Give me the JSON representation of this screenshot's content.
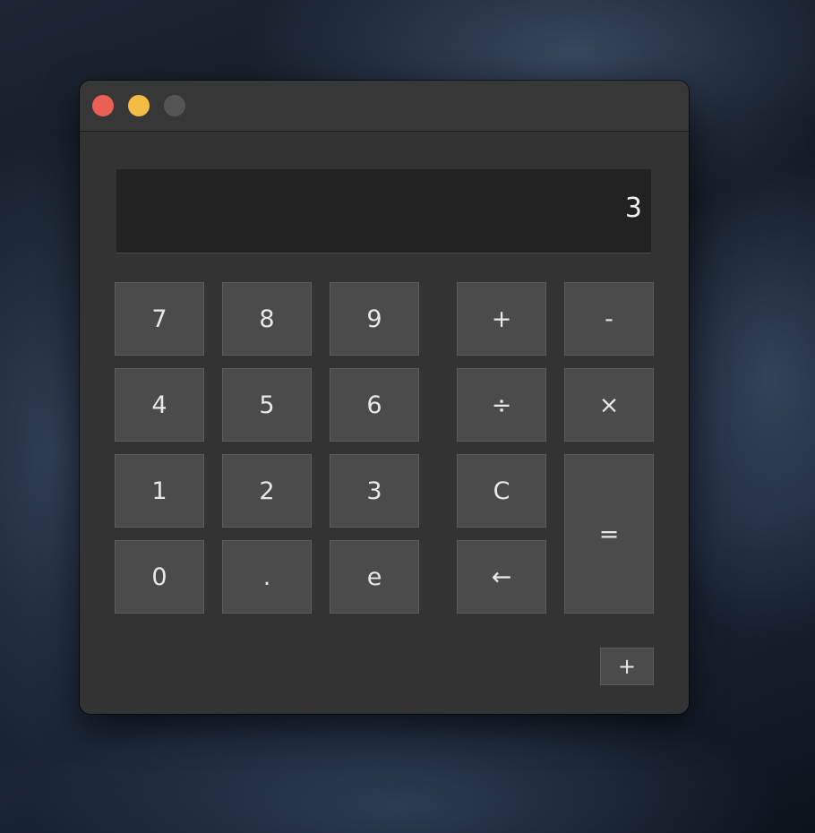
{
  "window": {
    "controls": [
      "close",
      "minimize",
      "zoom"
    ]
  },
  "display": {
    "value": "3"
  },
  "keys": {
    "k7": "7",
    "k8": "8",
    "k9": "9",
    "plus": "+",
    "minus": "-",
    "k4": "4",
    "k5": "5",
    "k6": "6",
    "divide": "÷",
    "multiply": "×",
    "k1": "1",
    "k2": "2",
    "k3": "3",
    "clear": "C",
    "equals": "=",
    "k0": "0",
    "dot": ".",
    "e": "e",
    "backspace": "←"
  },
  "footer": {
    "add_label": "+"
  },
  "colors": {
    "window": "#333333",
    "key": "#4b4b4b",
    "display": "#222222",
    "close": "#ec5f55",
    "minimize": "#f3bd45",
    "zoom_inactive": "#555555"
  }
}
